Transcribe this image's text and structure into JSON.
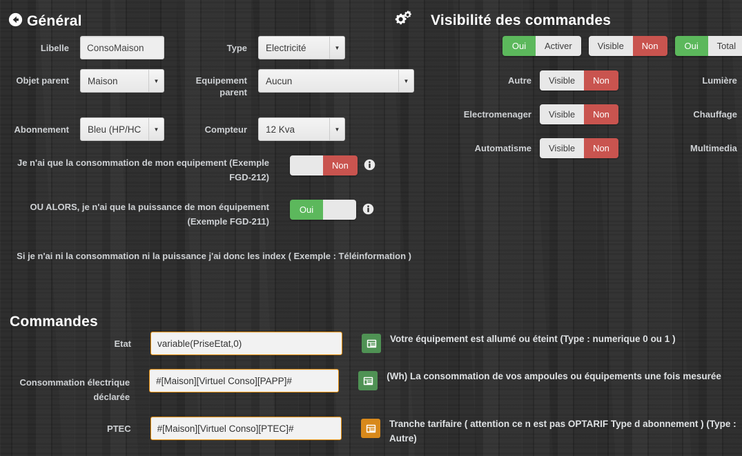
{
  "general": {
    "title": "Général",
    "back_icon": "arrow-circle-left-icon",
    "gear_icon": "cogs-icon",
    "fields": {
      "libelle_label": "Libelle",
      "libelle_value": "ConsoMaison",
      "type_label": "Type",
      "type_value": "Electricité",
      "objet_parent_label": "Objet parent",
      "objet_parent_value": "Maison",
      "equipement_parent_label": "Equipement parent",
      "equipement_parent_value": "Aucun",
      "abonnement_label": "Abonnement",
      "abonnement_value": "Bleu (HP/HC",
      "compteur_label": "Compteur",
      "compteur_value": "12 Kva"
    },
    "options": [
      {
        "label": "Je n'ai que la consommation de mon equipement (Exemple FGD-212)",
        "toggle_left": "",
        "toggle_right": "Non",
        "state": "off",
        "info_icon": "info-circle-icon"
      },
      {
        "label": "OU ALORS, je n'ai que la puissance de mon équipement (Exemple FGD-211)",
        "toggle_left": "Oui",
        "toggle_right": "",
        "state": "on",
        "info_icon": "info-circle-icon"
      }
    ],
    "note": "Si je n'ai ni la consommation ni la puissance j'ai donc les index ( Exemple : Téléinformation )"
  },
  "visibility": {
    "title": "Visibilité des commandes",
    "top_toggles": [
      {
        "left": "Oui",
        "right": "Activer",
        "state": "on"
      },
      {
        "left": "Visible",
        "right": "Non",
        "state": "off"
      },
      {
        "left": "Oui",
        "right": "Total",
        "state": "on"
      }
    ],
    "rows": [
      {
        "label_left": "Autre",
        "toggle_left": "Visible",
        "toggle_right": "Non",
        "state": "off",
        "label_right": "Lumière"
      },
      {
        "label_left": "Electromenager",
        "toggle_left": "Visible",
        "toggle_right": "Non",
        "state": "off",
        "label_right": "Chauffage"
      },
      {
        "label_left": "Automatisme",
        "toggle_left": "Visible",
        "toggle_right": "Non",
        "state": "off",
        "label_right": "Multimedia"
      }
    ]
  },
  "commandes": {
    "title": "Commandes",
    "rows": [
      {
        "label": "Etat",
        "value": "variable(PriseEtat,0)",
        "badge_color": "green",
        "badge_icon": "window-list-icon",
        "description": "Votre équipement est allumé ou éteint (Type : numerique 0 ou 1 )"
      },
      {
        "label": "Consommation électrique déclarée",
        "value": "#[Maison][Virtuel Conso][PAPP]#",
        "badge_color": "green",
        "badge_icon": "window-list-icon",
        "description": "(Wh) La consommation de vos ampoules ou équipements une fois mesurée"
      },
      {
        "label": "PTEC",
        "value": "#[Maison][Virtuel Conso][PTEC]#",
        "badge_color": "orange",
        "badge_icon": "window-list-icon",
        "description": "Tranche tarifaire ( attention ce n est pas OPTARIF Type d abonnement ) (Type : Autre)"
      }
    ]
  },
  "colors": {
    "green": "#5cb85c",
    "red": "#c9544f",
    "orange": "#d8891b",
    "input_border_orange": "#e8900c",
    "background": "#2e2e2e",
    "text": "#d8d8d8"
  }
}
